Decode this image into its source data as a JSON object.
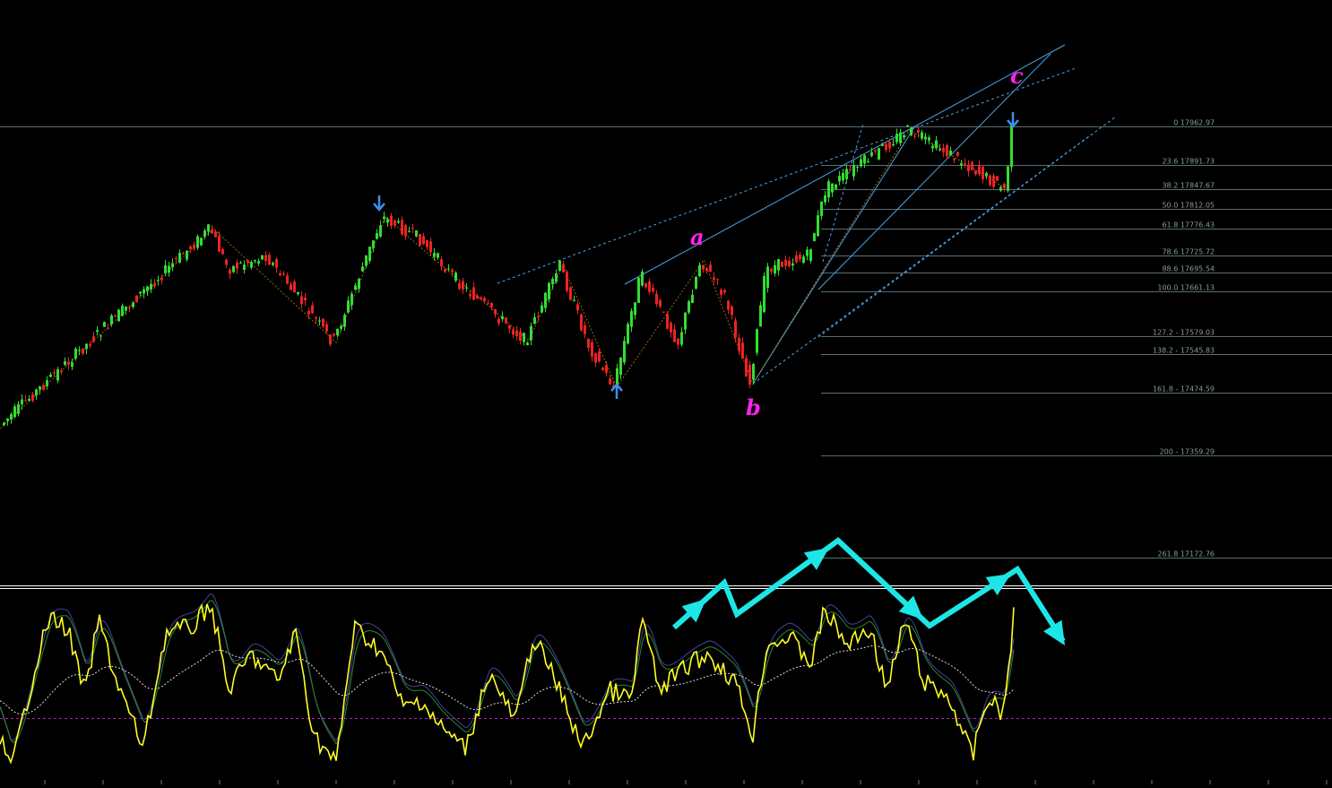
{
  "colors": {
    "background": "#000000",
    "bull_candle": "#33dd33",
    "bear_candle": "#ee2222",
    "fib_line": "#5a6e74",
    "channel_line": "#4aa3e6",
    "zigzag": "#b8860b",
    "wave_label": "#ff22ee",
    "fractal_arrow": "#3b8ff0",
    "osc_main": "#ffff22",
    "osc_signal": "#2a8a2a",
    "osc_signal2": "#4b3fa0",
    "osc_ma": "#dddddd",
    "osc_level": "#b022b0",
    "cyan_path": "#1ee6e6",
    "separator": "#ffffff"
  },
  "wave_labels": {
    "a": "a",
    "b": "b",
    "c": "c"
  },
  "chart_data": [
    {
      "type": "candlestick",
      "title": "",
      "instrument": "",
      "price_range": [
        17172,
        18100
      ],
      "fib_levels": [
        {
          "label": "0 17962.97",
          "price": 17962.97
        },
        {
          "label": "23.6 17891.73",
          "price": 17891.73
        },
        {
          "label": "38.2 17847.67",
          "price": 17847.67
        },
        {
          "label": "50.0 17812.05",
          "price": 17812.05
        },
        {
          "label": "61.8 17776.43",
          "price": 17776.43
        },
        {
          "label": "78.6 17725.72",
          "price": 17725.72
        },
        {
          "label": "88.6 17695.54",
          "price": 17695.54
        },
        {
          "label": "100.0 17661.13",
          "price": 17661.13
        },
        {
          "label": "127.2 - 17579.03",
          "price": 17579.03
        },
        {
          "label": "138.2 - 17545.83",
          "price": 17545.83
        },
        {
          "label": "161.8 -  17474.59",
          "price": 17474.59
        },
        {
          "label": "200 - 17359.29",
          "price": 17359.29
        },
        {
          "label": "261.8 17172.76",
          "price": 17172.76
        }
      ],
      "swing_points": [
        {
          "label": "",
          "price": 17360
        },
        {
          "label": "",
          "price": 17780
        },
        {
          "label": "",
          "price": 17560
        },
        {
          "label": "",
          "price": 17840
        },
        {
          "label": "",
          "price": 17455
        },
        {
          "label": "a",
          "price": 17710
        },
        {
          "label": "b",
          "price": 17460
        },
        {
          "label": "",
          "price": 17963
        },
        {
          "label": "c",
          "price": 17960
        }
      ]
    },
    {
      "type": "line",
      "title": "",
      "series": [
        {
          "name": "",
          "role": "main"
        },
        {
          "name": "",
          "role": "signal"
        },
        {
          "name": "",
          "role": "moving-average"
        }
      ]
    }
  ]
}
